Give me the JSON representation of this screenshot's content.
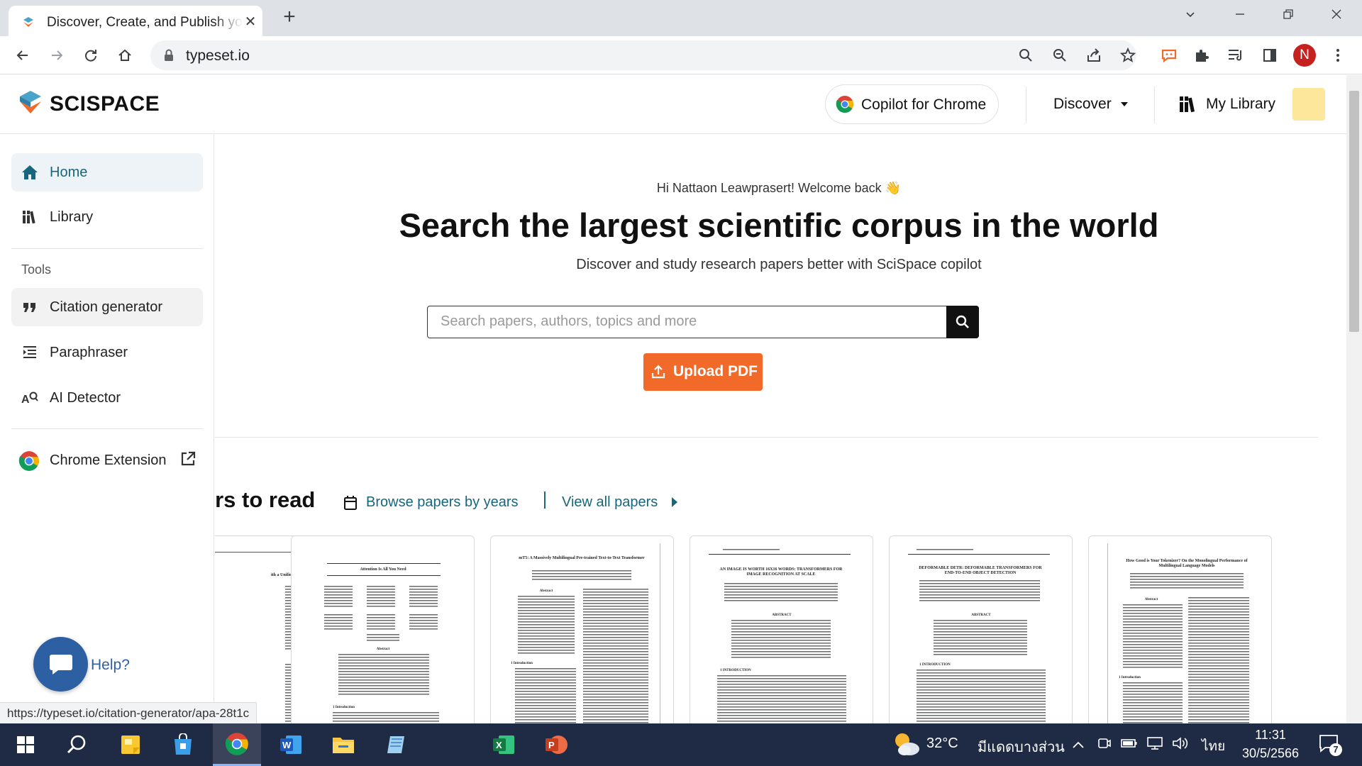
{
  "browser": {
    "tab_title": "Discover, Create, and Publish your research paper | SciSpace by Typeset",
    "url": "typeset.io",
    "profile_initial": "N",
    "status_link": "https://typeset.io/citation-generator/apa-28t1c"
  },
  "header": {
    "logo_text": "SCISPACE",
    "copilot_label": "Copilot for Chrome",
    "discover_label": "Discover",
    "library_label": "My Library"
  },
  "sidebar": {
    "home": "Home",
    "library": "Library",
    "tools_heading": "Tools",
    "citation": "Citation generator",
    "paraphraser": "Paraphraser",
    "ai_detector": "AI Detector",
    "chrome_extension": "Chrome Extension"
  },
  "main": {
    "welcome": "Hi Nattaon Leawprasert! Welcome back 👋",
    "headline": "Search the largest scientific corpus in the world",
    "subline": "Discover and study research papers better with SciSpace copilot",
    "search_placeholder": "Search papers, authors, topics and more",
    "upload_label": "Upload PDF",
    "section_title": "Papers to read",
    "browse_label": "Browse papers by years",
    "view_all_label": "View all papers"
  },
  "papers": [
    {
      "title": "ith a Unified"
    },
    {
      "title": "Attention Is All You Need"
    },
    {
      "title": "mT5: A Massively Multilingual Pre-trained Text-to-Text Transformer"
    },
    {
      "title": "AN IMAGE IS WORTH 16X16 WORDS: TRANSFORMERS FOR IMAGE RECOGNITION AT SCALE"
    },
    {
      "title": "DEFORMABLE DETR: DEFORMABLE TRANSFORMERS FOR END-TO-END OBJECT DETECTION"
    },
    {
      "title": "How Good is Your Tokenizer? On the Monolingual Performance of Multilingual Language Models"
    }
  ],
  "help": {
    "label": "Help?"
  },
  "taskbar": {
    "temperature": "32°C",
    "weather": "มีแดดบางส่วน",
    "language": "ไทย",
    "time": "11:31",
    "date": "30/5/2566",
    "notifications": "7"
  },
  "colors": {
    "accent_teal": "#16667d",
    "upload_orange": "#f26a2a",
    "help_blue": "#2d5fa3"
  }
}
